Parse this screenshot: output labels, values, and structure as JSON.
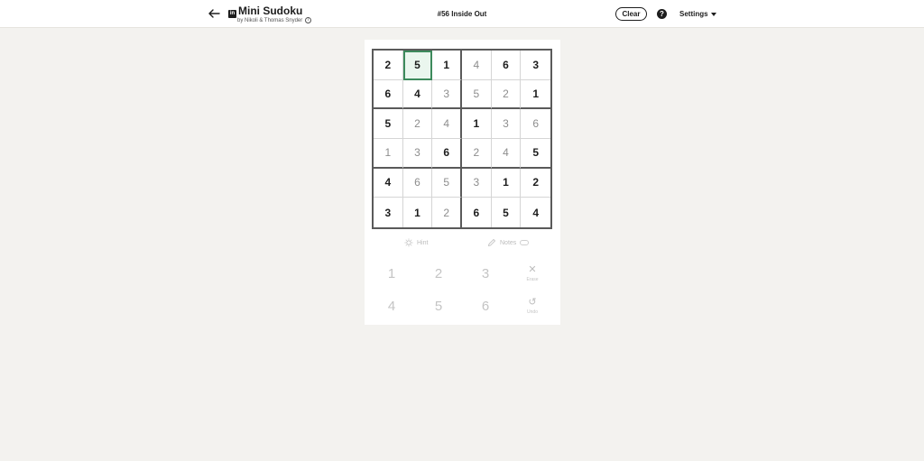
{
  "header": {
    "title": "Mini Sudoku",
    "byline": "by Nikoli & Thomas Snyder",
    "brand_logo_text": "in",
    "puzzle_name": "#56 Inside Out",
    "clear_label": "Clear",
    "help_glyph": "?",
    "settings_label": "Settings"
  },
  "grid": {
    "rows": [
      [
        {
          "v": "2",
          "t": "given"
        },
        {
          "v": "5",
          "t": "given"
        },
        {
          "v": "1",
          "t": "given"
        },
        {
          "v": "4",
          "t": "entry"
        },
        {
          "v": "6",
          "t": "given"
        },
        {
          "v": "3",
          "t": "given"
        }
      ],
      [
        {
          "v": "6",
          "t": "given"
        },
        {
          "v": "4",
          "t": "given"
        },
        {
          "v": "3",
          "t": "entry"
        },
        {
          "v": "5",
          "t": "entry"
        },
        {
          "v": "2",
          "t": "entry"
        },
        {
          "v": "1",
          "t": "given"
        }
      ],
      [
        {
          "v": "5",
          "t": "given"
        },
        {
          "v": "2",
          "t": "entry"
        },
        {
          "v": "4",
          "t": "entry"
        },
        {
          "v": "1",
          "t": "given"
        },
        {
          "v": "3",
          "t": "entry"
        },
        {
          "v": "6",
          "t": "entry"
        }
      ],
      [
        {
          "v": "1",
          "t": "entry"
        },
        {
          "v": "3",
          "t": "entry"
        },
        {
          "v": "6",
          "t": "given"
        },
        {
          "v": "2",
          "t": "entry"
        },
        {
          "v": "4",
          "t": "entry"
        },
        {
          "v": "5",
          "t": "given"
        }
      ],
      [
        {
          "v": "4",
          "t": "given"
        },
        {
          "v": "6",
          "t": "entry"
        },
        {
          "v": "5",
          "t": "entry"
        },
        {
          "v": "3",
          "t": "entry"
        },
        {
          "v": "1",
          "t": "given"
        },
        {
          "v": "2",
          "t": "given"
        }
      ],
      [
        {
          "v": "3",
          "t": "given"
        },
        {
          "v": "1",
          "t": "given"
        },
        {
          "v": "2",
          "t": "entry"
        },
        {
          "v": "6",
          "t": "given"
        },
        {
          "v": "5",
          "t": "given"
        },
        {
          "v": "4",
          "t": "given"
        }
      ]
    ],
    "selected": {
      "row": 0,
      "col": 1
    }
  },
  "tools": {
    "hint_label": "Hint",
    "notes_label": "Notes"
  },
  "keypad": {
    "numbers": [
      "1",
      "2",
      "3",
      "4",
      "5",
      "6"
    ],
    "erase_label": "Erase",
    "undo_label": "Undo"
  },
  "colors": {
    "selected_border": "#3d8a5c",
    "grid_border": "#5a5a5a",
    "background": "#f3f2ef"
  }
}
